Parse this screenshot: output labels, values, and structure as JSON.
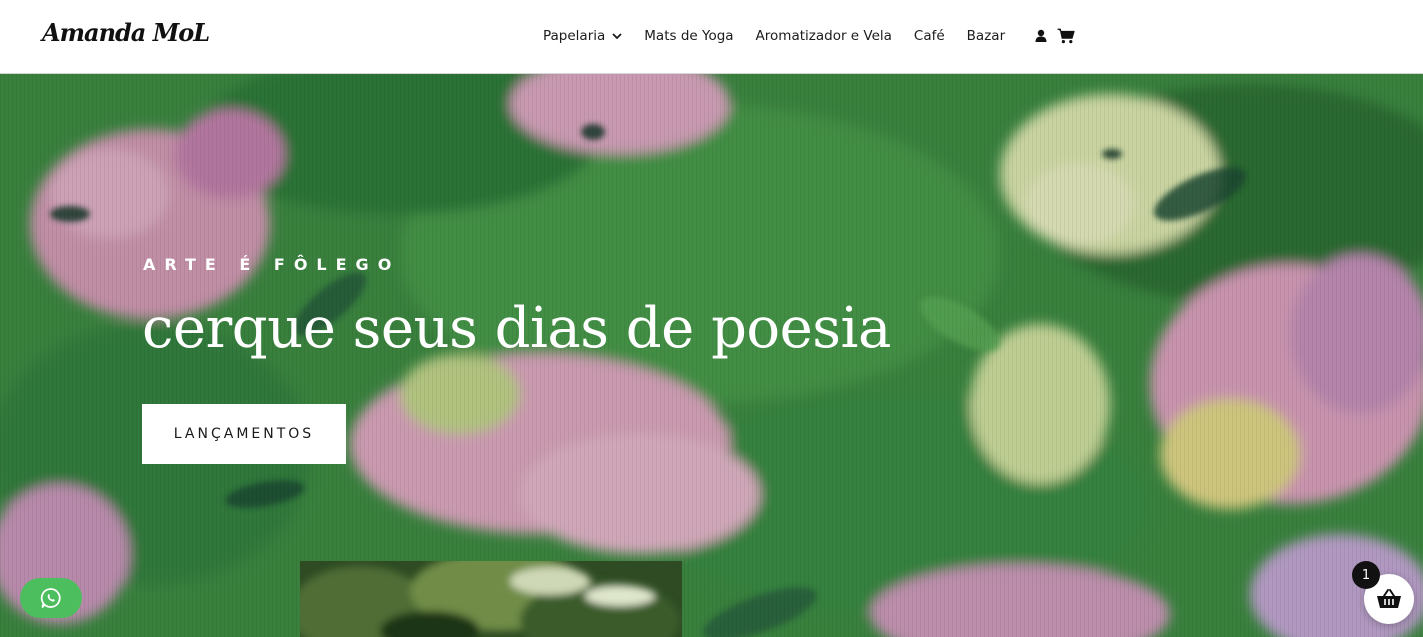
{
  "brand": {
    "logo_text": "Amanda MoL"
  },
  "nav": {
    "items": [
      {
        "label": "Papelaria",
        "has_dropdown": true
      },
      {
        "label": "Mats de Yoga"
      },
      {
        "label": "Aromatizador e Vela"
      },
      {
        "label": "Café"
      },
      {
        "label": "Bazar"
      }
    ],
    "icons": [
      "user-icon",
      "cart-icon"
    ]
  },
  "hero": {
    "eyebrow": "ARTE É FÔLEGO",
    "headline": "cerque seus dias de poesia",
    "cta_label": "LANÇAMENTOS"
  },
  "floating": {
    "whatsapp_icon": "whatsapp-icon",
    "basket_icon": "basket-icon",
    "basket_count": "1"
  },
  "colors": {
    "hero_green": "#3f8a43",
    "whatsapp_green": "#4cbe5e",
    "nav_text": "#1c1c1c"
  }
}
